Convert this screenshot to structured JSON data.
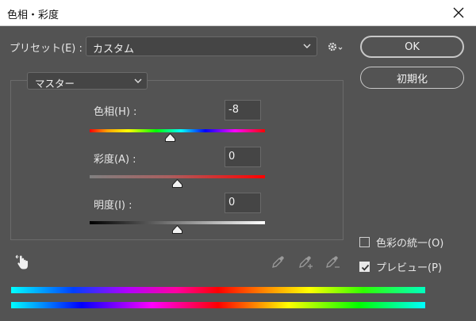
{
  "window": {
    "title": "色相・彩度"
  },
  "preset": {
    "label": "プリセット(E) :",
    "value": "カスタム"
  },
  "buttons": {
    "ok": "OK",
    "reset": "初期化"
  },
  "channel": {
    "value": "マスター"
  },
  "sliders": {
    "hue": {
      "label": "色相(H) :",
      "value": "-8",
      "level": 0.46
    },
    "saturation": {
      "label": "彩度(A) :",
      "value": "0",
      "level": 0.5
    },
    "lightness": {
      "label": "明度(I) :",
      "value": "0",
      "level": 0.5
    }
  },
  "options": {
    "colorize": {
      "label": "色彩の統一(O)",
      "checked": false
    },
    "preview": {
      "label": "プレビュー(P)",
      "checked": true
    }
  },
  "icons": [
    "close-icon",
    "chevron-down-icon",
    "gear-icon",
    "hand-adjust-icon",
    "eyedropper-icon",
    "eyedropper-plus-icon",
    "eyedropper-minus-icon",
    "checkmark-icon"
  ]
}
